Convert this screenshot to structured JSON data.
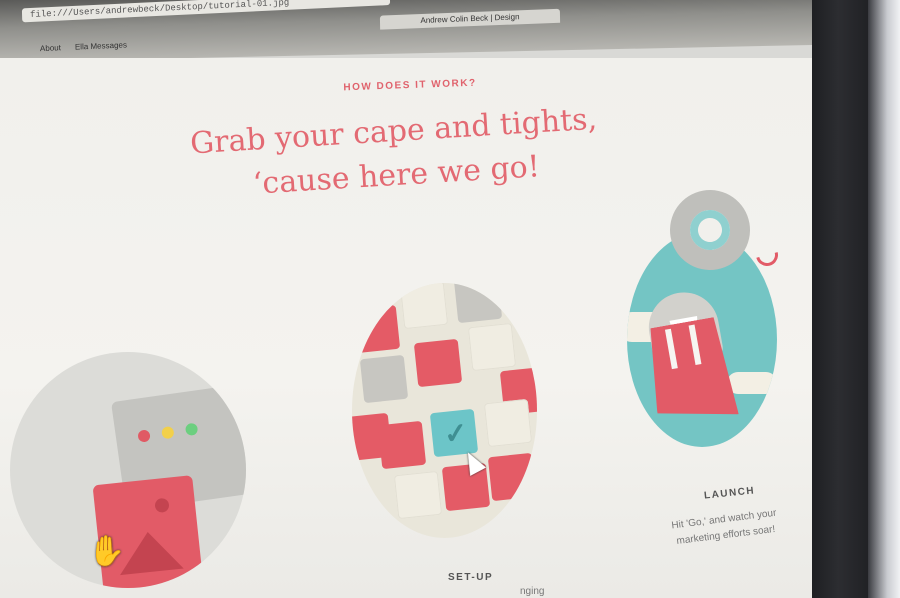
{
  "browser": {
    "url": "file:///Users/andrewbeck/Desktop/tutorial-01.jpg",
    "tab_title": "Andrew Colin Beck | Design",
    "bookmarks": [
      "About",
      "Ella Messages"
    ]
  },
  "section": {
    "eyebrow": "HOW DOES IT WORK?",
    "headline_line1": "Grab your cape and tights,",
    "headline_line2": "‘cause here we go!"
  },
  "steps": {
    "setup": {
      "label": "SET-UP",
      "desc_fragment": "nging"
    },
    "launch": {
      "label": "LAUNCH",
      "desc": "Hit 'Go,' and watch your marketing efforts soar!"
    }
  },
  "colors": {
    "accent_red": "#e36a73",
    "teal": "#74c5c4",
    "cream": "#f1f0ec"
  },
  "icons": {
    "hand_cursor": "hand-cursor-icon",
    "arrow_cursor": "arrow-cursor-icon",
    "check": "check-icon"
  }
}
